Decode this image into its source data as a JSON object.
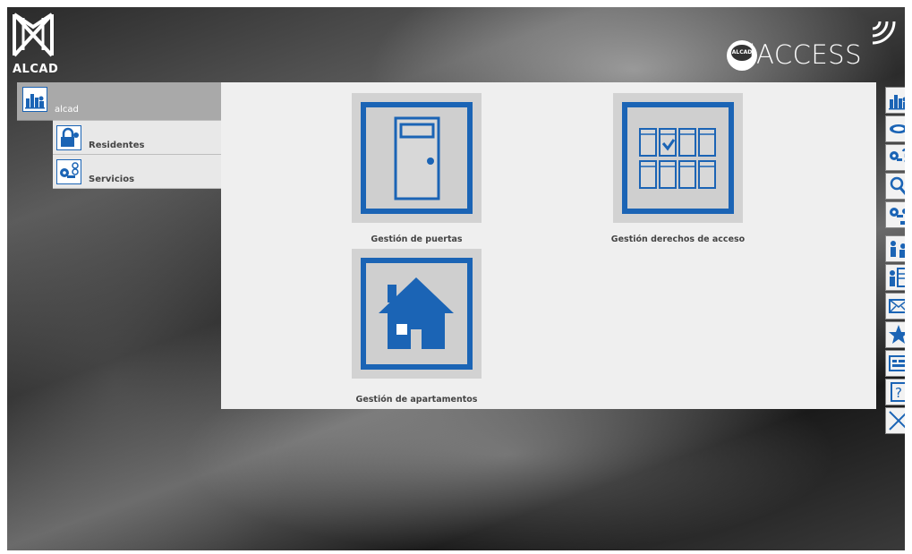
{
  "logo": {
    "text": "ALCAD"
  },
  "brand": {
    "name": "iACCESS",
    "badge": "ALCAD"
  },
  "menu": {
    "root": {
      "label": "alcad",
      "icon": "building-chart-icon"
    },
    "items": [
      {
        "label": "Residentes",
        "icon": "lock-key-icon"
      },
      {
        "label": "Servicios",
        "icon": "key-clock-icon"
      }
    ]
  },
  "main": {
    "tiles": [
      {
        "label": "Gestión de puertas",
        "icon": "door-icon"
      },
      {
        "label": "Gestión derechos de acceso",
        "icon": "lockers-icon"
      },
      {
        "label": "Gestión de apartamentos",
        "icon": "house-icon"
      }
    ]
  },
  "toolbar": {
    "buttons": [
      {
        "icon": "building-chart-icon"
      },
      {
        "icon": "id-card-icon"
      },
      {
        "icon": "key-question-icon"
      },
      {
        "icon": "search-icon"
      },
      {
        "icon": "key-history-icon"
      },
      {
        "icon": "users-icon"
      },
      {
        "icon": "user-list-icon"
      },
      {
        "icon": "envelope-icon"
      },
      {
        "icon": "star-icon"
      },
      {
        "icon": "terminal-icon"
      },
      {
        "icon": "help-icon"
      },
      {
        "icon": "close-icon"
      }
    ]
  },
  "colors": {
    "accent": "#1b64b5",
    "panel": "#efefef",
    "menu_root": "#a9a9a9"
  }
}
